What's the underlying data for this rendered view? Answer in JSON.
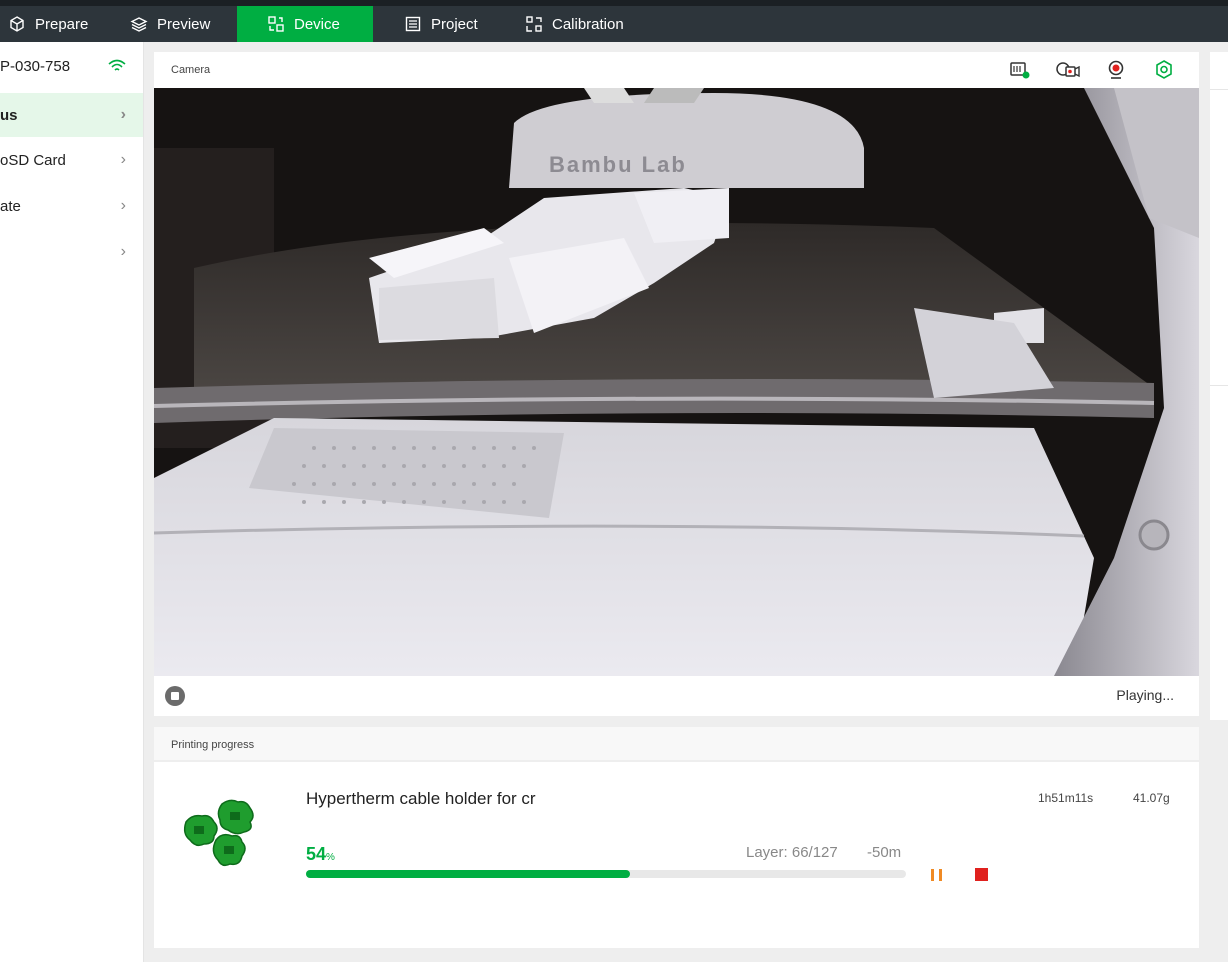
{
  "nav": {
    "tabs": [
      {
        "label": "Prepare",
        "icon": "cube-icon"
      },
      {
        "label": "Preview",
        "icon": "layers-icon"
      },
      {
        "label": "Device",
        "icon": "device-icon",
        "active": true
      },
      {
        "label": "Project",
        "icon": "project-icon"
      },
      {
        "label": "Calibration",
        "icon": "calibration-icon"
      }
    ]
  },
  "sidebar": {
    "printer_name": "P-030-758",
    "items": [
      {
        "label": "us",
        "active": true
      },
      {
        "label": "oSD Card"
      },
      {
        "label": "ate"
      },
      {
        "label": ""
      }
    ]
  },
  "camera": {
    "title": "Camera",
    "tools": [
      "sd-card-icon",
      "record-icon",
      "webcam-icon",
      "settings-icon"
    ],
    "status": "Playing..."
  },
  "progress": {
    "title": "Printing progress",
    "job_name": "Hypertherm cable holder for cr",
    "time": "1h51m11s",
    "weight": "41.07g",
    "percent_value": "54",
    "percent_unit": "%",
    "percent": 54,
    "layer": "Layer: 66/127",
    "remaining": "-50m"
  },
  "colors": {
    "accent": "#00ae42",
    "pause": "#f08a24",
    "stop": "#e0211e"
  }
}
